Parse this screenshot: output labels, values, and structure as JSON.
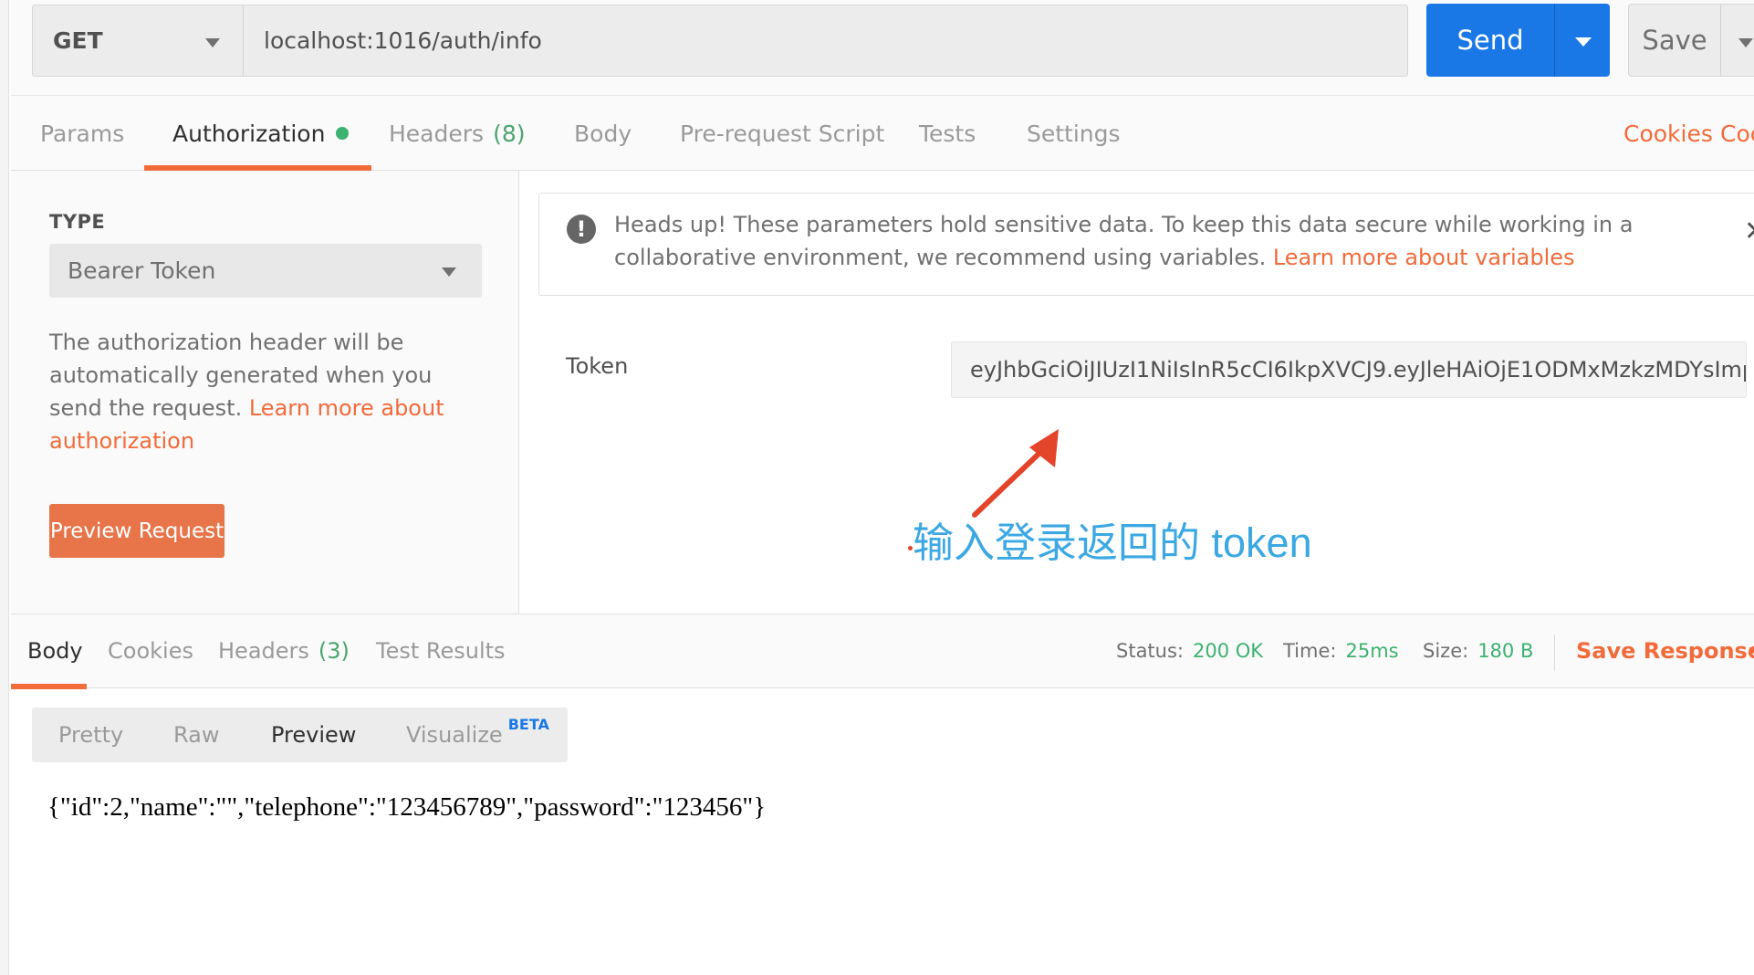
{
  "request": {
    "method": "GET",
    "url": "localhost:1016/auth/info",
    "send_label": "Send",
    "save_label": "Save"
  },
  "request_tabs": {
    "params": "Params",
    "authorization": "Authorization",
    "headers": "Headers",
    "headers_count": "(8)",
    "body": "Body",
    "pre_request": "Pre-request Script",
    "tests": "Tests",
    "settings": "Settings",
    "cookies": "Cookies",
    "code": "Coc"
  },
  "auth": {
    "type_label": "TYPE",
    "type_value": "Bearer Token",
    "desc_text": "The authorization header will be automatically generated when you send the request. ",
    "desc_link": "Learn more about authorization",
    "preview_button": "Preview Request",
    "alert_text": "Heads up! These parameters hold sensitive data. To keep this data secure while working in a collaborative environment, we recommend using variables. ",
    "alert_link": "Learn more about variables",
    "alert_icon": "!",
    "alert_close": "✕",
    "token_label": "Token",
    "token_value": "eyJhbGciOiJIUzI1NiIsInR5cCI6IkpXVCJ9.eyJleHAiOjE1ODMxMzkzMDYsImp..."
  },
  "annotation": {
    "text_cn": "输入登录返回的",
    "text_token": " token",
    "color": "#3ba8e3",
    "arrow_color": "#e4442a"
  },
  "response": {
    "tabs": {
      "body": "Body",
      "cookies": "Cookies",
      "headers": "Headers",
      "headers_count": "(3)",
      "test_results": "Test Results"
    },
    "status_label": "Status:",
    "status_value": "200 OK",
    "time_label": "Time:",
    "time_value": "25ms",
    "size_label": "Size:",
    "size_value": "180 B",
    "save_response": "Save Response",
    "view_modes": {
      "pretty": "Pretty",
      "raw": "Raw",
      "preview": "Preview",
      "visualize": "Visualize",
      "beta": "BETA"
    },
    "body": "{\"id\":2,\"name\":\"\",\"telephone\":\"123456789\",\"password\":\"123456\"}"
  },
  "colors": {
    "accent": "#f26b3a",
    "send": "#1a78e6",
    "success": "#3bb270"
  }
}
